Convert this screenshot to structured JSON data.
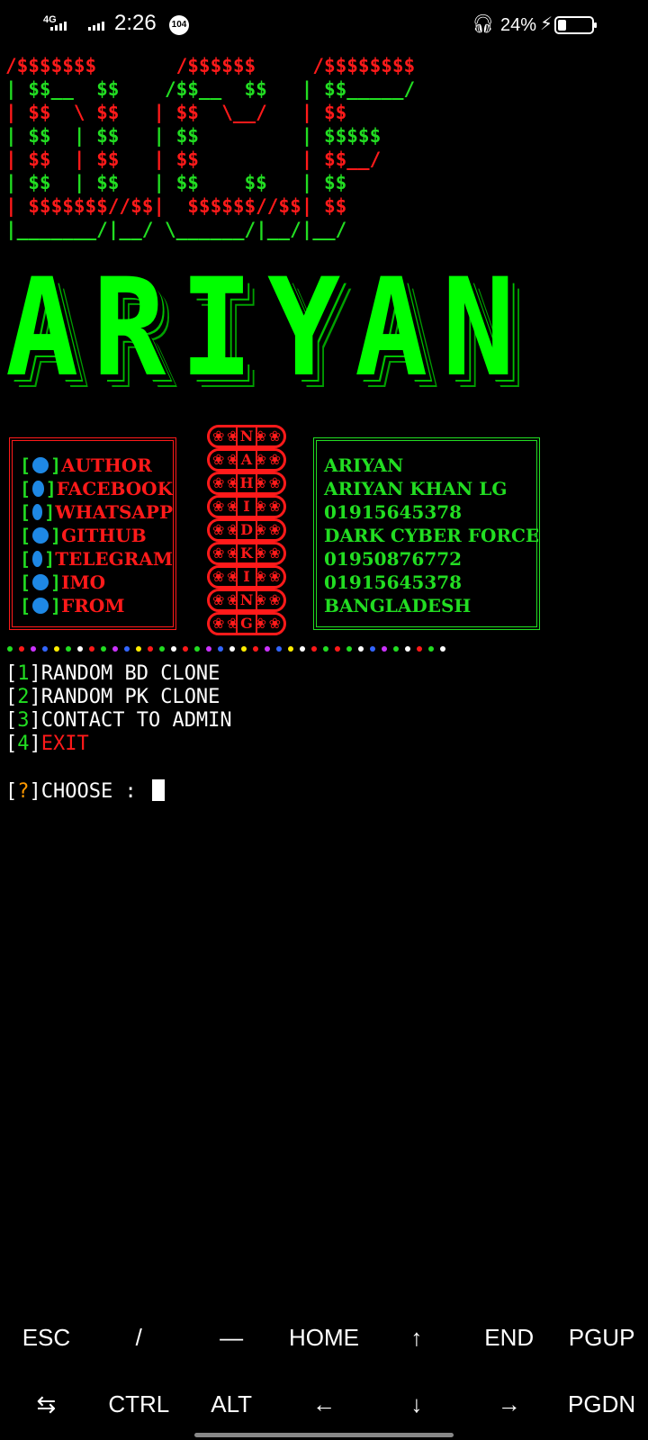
{
  "status_bar": {
    "network": "4G",
    "time": "2:26",
    "notification_badge": "104",
    "battery_percent": "24%",
    "battery_level": 0.24
  },
  "ascii_banner": {
    "lines": [
      {
        "text": "/$$$$$$$       /$$$$$$     /$$$$$$$$",
        "color": "#ff1a1a"
      },
      {
        "text": "| $$__  $$    /$$__  $$   | $$_____/",
        "color": "#22dd22"
      },
      {
        "text": "| $$  \\ $$   | $$  \\__/   | $$",
        "color": "#ff1a1a"
      },
      {
        "text": "| $$  | $$   | $$         | $$$$$",
        "color": "#22dd22"
      },
      {
        "text": "| $$  | $$   | $$         | $$__/",
        "color": "#ff1a1a"
      },
      {
        "text": "| $$  | $$   | $$    $$   | $$",
        "color": "#22dd22"
      },
      {
        "text": "| $$$$$$$//$$|  $$$$$$//$$| $$",
        "color": "#ff1a1a"
      },
      {
        "text": "|_______/|__/ \\______/|__/|__/",
        "color": "#22dd22"
      }
    ]
  },
  "logo": {
    "letters": [
      "A",
      "R",
      "I",
      "Y",
      "A",
      "N"
    ]
  },
  "info_left": {
    "items": [
      "AUTHOR",
      "FACEBOOK",
      "WHATSAPP",
      "GITHUB",
      "TELEGRAM",
      "IMO",
      "FROM"
    ]
  },
  "info_center": {
    "letters": [
      "N",
      "A",
      "H",
      "I",
      "D",
      "K",
      "I",
      "N",
      "G"
    ]
  },
  "info_right": {
    "items": [
      "ARIYAN",
      "ARIYAN KHAN LG",
      "01915645378",
      "DARK CYBER FORCE",
      "01950876772",
      "01915645378",
      "BANGLADESH"
    ]
  },
  "dots_colors": [
    "#22dd22",
    "#ff1a1a",
    "#cc33ff",
    "#3366ff",
    "#ffee00",
    "#22dd22",
    "#ffffff",
    "#ff1a1a",
    "#22dd22",
    "#cc33ff",
    "#3366ff",
    "#ffee00",
    "#ff1a1a",
    "#22dd22",
    "#ffffff",
    "#ff1a1a",
    "#22dd22",
    "#cc33ff",
    "#3366ff",
    "#ffffff",
    "#ffee00",
    "#ff1a1a",
    "#cc33ff",
    "#3366ff",
    "#ffee00",
    "#ffffff",
    "#ff1a1a",
    "#22dd22",
    "#ff1a1a",
    "#22dd22",
    "#ffffff",
    "#3366ff",
    "#cc33ff",
    "#22dd22",
    "#ffffff",
    "#ff1a1a",
    "#22dd22",
    "#ffffff"
  ],
  "menu": {
    "items": [
      {
        "num": "1",
        "label": "RANDOM BD CLONE"
      },
      {
        "num": "2",
        "label": "RANDOM PK CLONE"
      },
      {
        "num": "3",
        "label": "CONTACT TO ADMIN"
      },
      {
        "num": "4",
        "label": "EXIT"
      }
    ],
    "prompt_mark": "?",
    "prompt_label": "CHOOSE : "
  },
  "extra_keys": {
    "row1": [
      "ESC",
      "/",
      "—",
      "HOME",
      "↑",
      "END",
      "PGUP"
    ],
    "row2": [
      "⇆",
      "CTRL",
      "ALT",
      "←",
      "↓",
      "→",
      "PGDN"
    ]
  }
}
